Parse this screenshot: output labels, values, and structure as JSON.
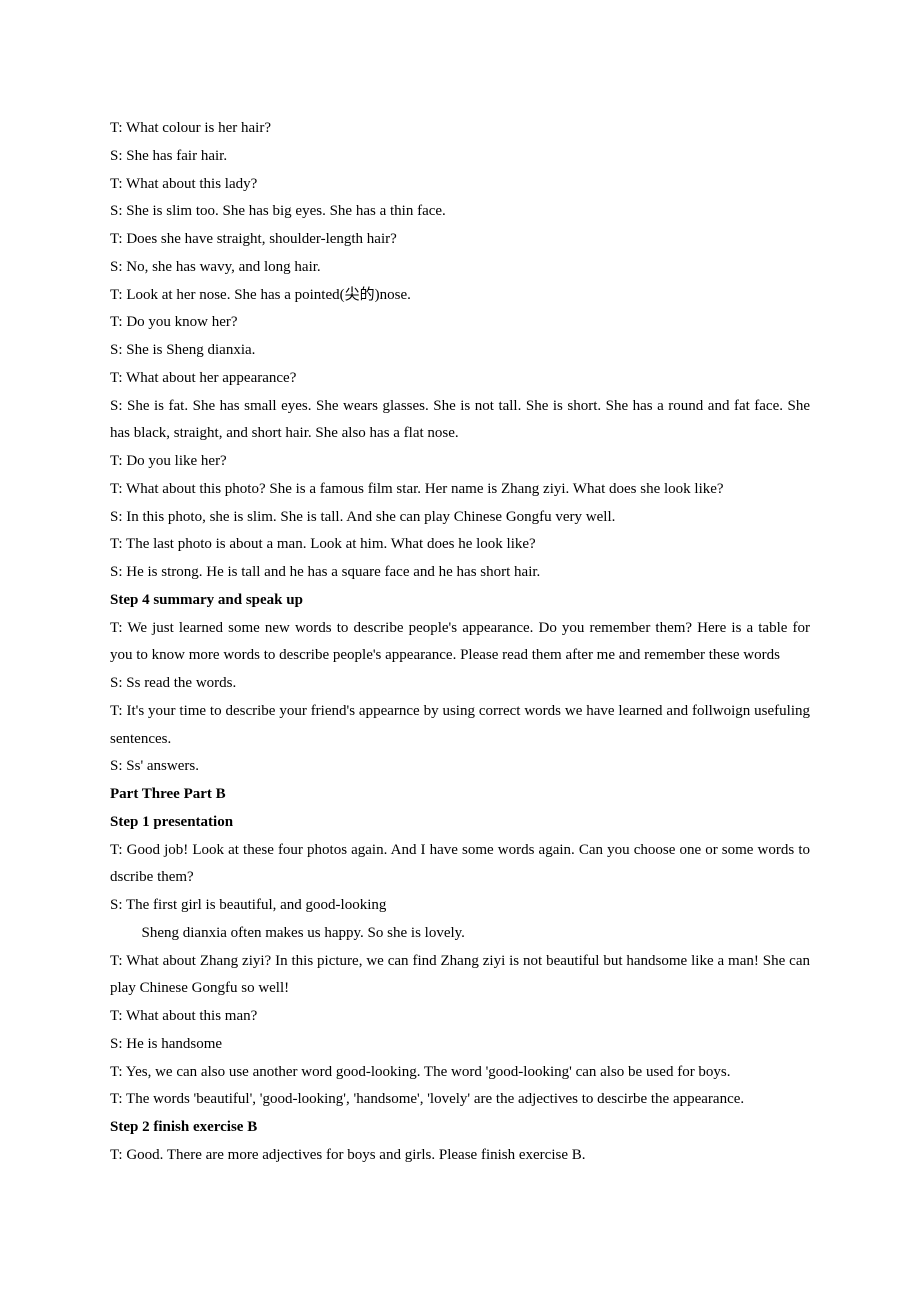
{
  "lines": [
    {
      "text": "T:  What colour is her hair?"
    },
    {
      "text": "S:  She has fair hair."
    },
    {
      "text": "T:  What about this lady?"
    },
    {
      "text": "S:  She is slim too. She has big eyes. She has a thin face."
    },
    {
      "text": "T:  Does she have straight, shoulder-length hair?"
    },
    {
      "text": "S:  No, she has wavy, and long hair."
    },
    {
      "text": "T:  Look at her nose. She has a pointed(尖的)nose."
    },
    {
      "text": "T:  Do you know her?"
    },
    {
      "text": "S:  She is Sheng dianxia."
    },
    {
      "text": "T:  What about her appearance?"
    },
    {
      "text": "S:  She is fat. She has small eyes. She wears glasses. She is not tall. She is short. She has a round and fat face. She has black, straight, and short hair. She also has a flat nose."
    },
    {
      "text": "T:  Do you like her?"
    },
    {
      "text": "T:  What about this photo? She is a famous film star. Her name is Zhang ziyi. What does she look like?"
    },
    {
      "text": "S:  In this photo, she is slim. She is tall. And she can play Chinese Gongfu very well."
    },
    {
      "text": "T:  The last photo is about a man. Look at him. What does he look like?"
    },
    {
      "text": "S:  He is strong. He is tall and he has a square face and he has short hair."
    },
    {
      "text": "Step 4 summary and speak up",
      "bold": true
    },
    {
      "text": "T:  We just learned some new words to describe people's appearance. Do you remember them? Here is a table for you to know more words to describe people's appearance. Please read them after me and remember these words"
    },
    {
      "text": "S:  Ss read the words."
    },
    {
      "text": "T:  It's your time to describe your friend's appearnce by using correct words we have learned and follwoign usefuling sentences."
    },
    {
      "text": "S:  Ss' answers."
    },
    {
      "text": "Part Three Part B",
      "bold": true
    },
    {
      "text": "Step 1 presentation",
      "bold": true
    },
    {
      "text": "T:  Good job! Look at these four photos again. And I have some words again. Can you choose one or some words to dscribe them?"
    },
    {
      "text": "S:  The first girl is beautiful, and good-looking"
    },
    {
      "text": "Sheng dianxia often makes us happy. So she is lovely.",
      "indent": true
    },
    {
      "text": "T:  What about Zhang ziyi? In this picture, we can find Zhang ziyi is not beautiful but handsome like a man! She can play Chinese Gongfu so well!"
    },
    {
      "text": "T:  What about this man?"
    },
    {
      "text": "S:  He is handsome"
    },
    {
      "text": "T:  Yes, we can also use another word good-looking. The word 'good-looking' can also be used for boys."
    },
    {
      "text": "T: The words 'beautiful', 'good-looking', 'handsome', 'lovely' are the adjectives to descirbe the appearance."
    },
    {
      "text": "Step 2 finish exercise B",
      "bold": true
    },
    {
      "text": "T:  Good. There are more adjectives for boys and girls. Please finish exercise B."
    }
  ]
}
